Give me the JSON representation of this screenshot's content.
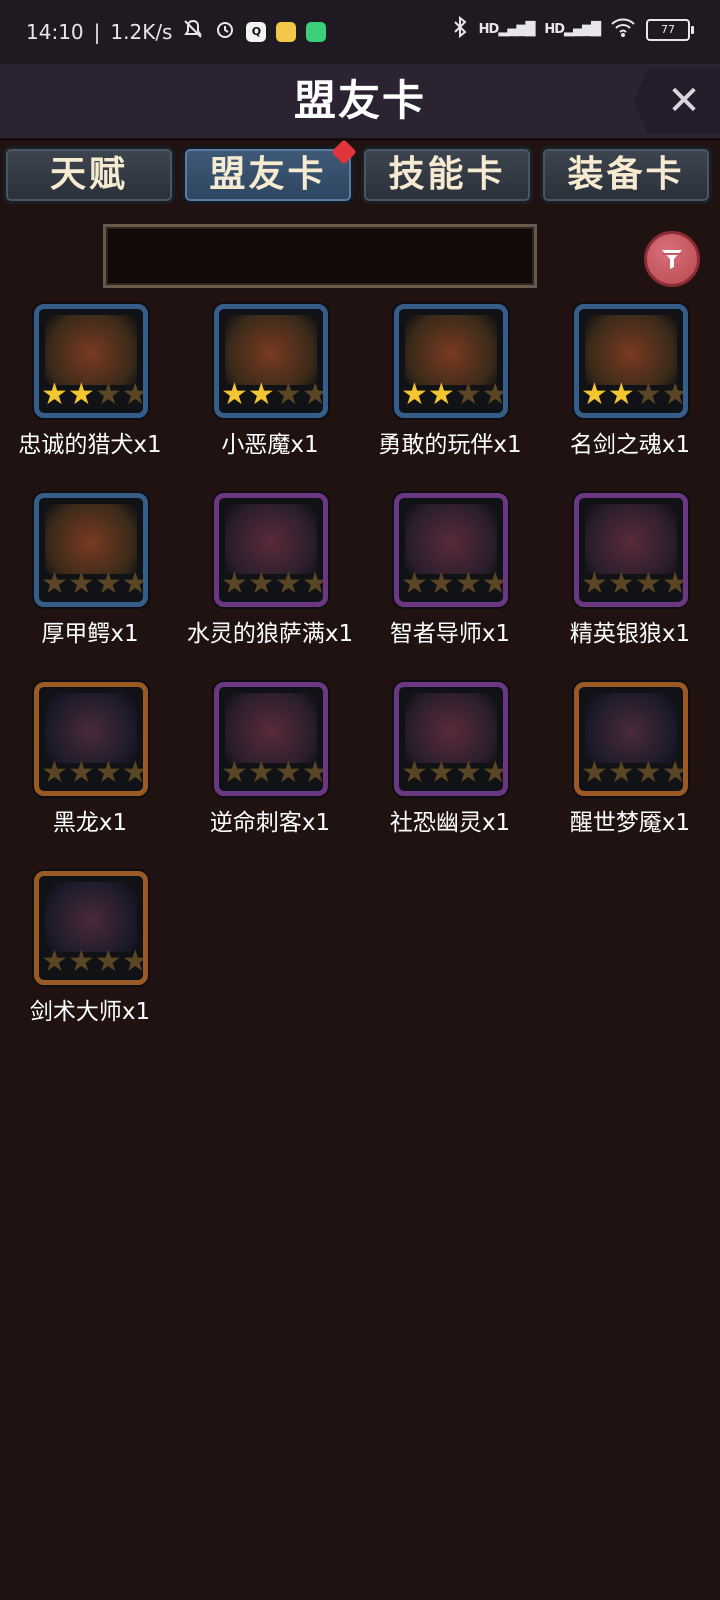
{
  "status_bar": {
    "time": "14:10",
    "speed": "1.2K/s",
    "signal1": "HD",
    "signal2": "HD",
    "battery": "77"
  },
  "header": {
    "title": "盟友卡",
    "close_label": "✕"
  },
  "tabs": [
    {
      "label": "天赋",
      "active": false
    },
    {
      "label": "盟友卡",
      "active": true,
      "badge": true
    },
    {
      "label": "技能卡",
      "active": false
    },
    {
      "label": "装备卡",
      "active": false
    }
  ],
  "search": {
    "value": ""
  },
  "cards": [
    {
      "label": "忠诚的猎犬x1",
      "frame": "blue",
      "stars": 2
    },
    {
      "label": "小恶魔x1",
      "frame": "blue",
      "stars": 2
    },
    {
      "label": "勇敢的玩伴x1",
      "frame": "blue",
      "stars": 2
    },
    {
      "label": "名剑之魂x1",
      "frame": "blue",
      "stars": 2
    },
    {
      "label": "厚甲鳄x1",
      "frame": "blue",
      "stars": 0
    },
    {
      "label": "水灵的狼萨满x1",
      "frame": "purple",
      "stars": 0
    },
    {
      "label": "智者导师x1",
      "frame": "purple",
      "stars": 0
    },
    {
      "label": "精英银狼x1",
      "frame": "purple",
      "stars": 0
    },
    {
      "label": "黑龙x1",
      "frame": "orange",
      "stars": 0
    },
    {
      "label": "逆命刺客x1",
      "frame": "purple",
      "stars": 0
    },
    {
      "label": "社恐幽灵x1",
      "frame": "purple",
      "stars": 0
    },
    {
      "label": "醒世梦魇x1",
      "frame": "orange",
      "stars": 0
    },
    {
      "label": "剑术大师x1",
      "frame": "orange",
      "stars": 0
    }
  ],
  "colors": {
    "background": "#1f1210",
    "frame_blue": "#355d87",
    "frame_purple": "#6c3781",
    "frame_orange": "#9b5a23",
    "star_on": "#f3c531",
    "star_off": "#5a4624",
    "badge_red": "#e0353d",
    "filter_button": "#c85a63"
  },
  "icons": {
    "close": "close-icon",
    "filter": "filter-icon",
    "bluetooth": "bluetooth-icon",
    "wifi": "wifi-icon",
    "alarm": "alarm-icon",
    "mute": "bell-off-icon"
  }
}
